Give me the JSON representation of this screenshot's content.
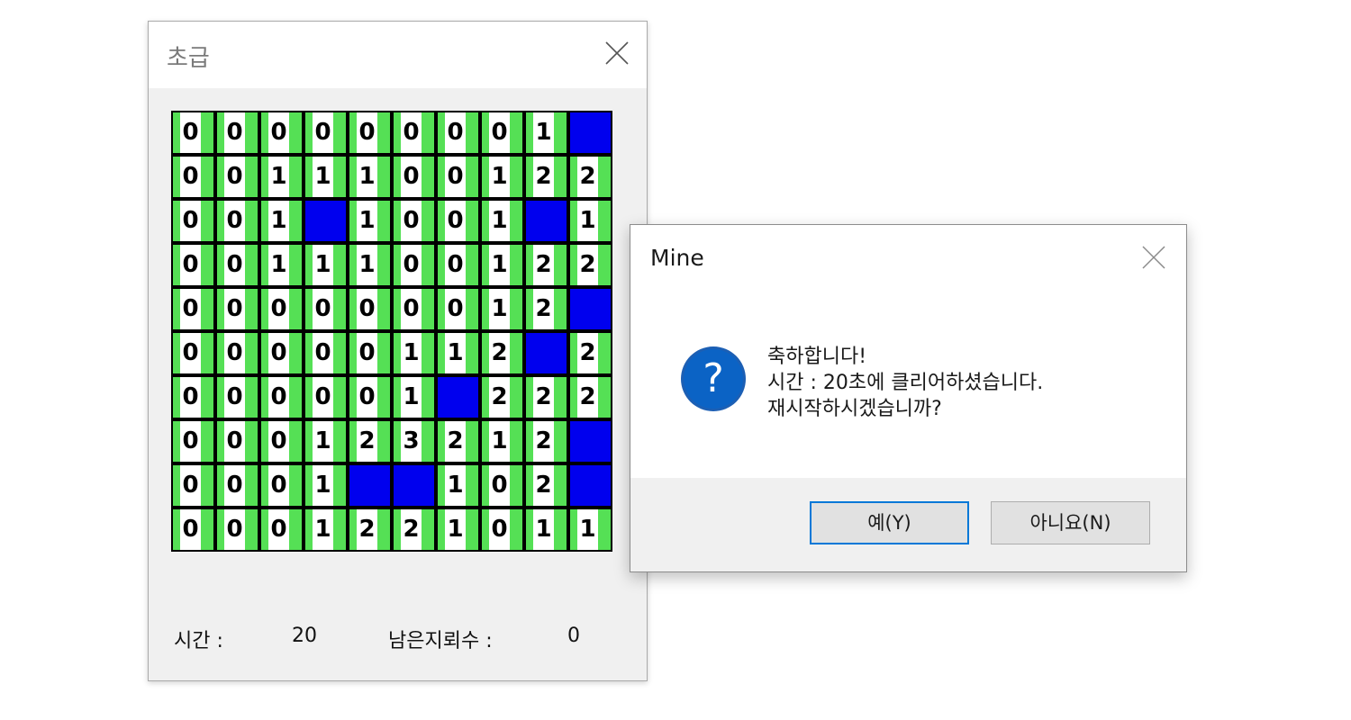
{
  "game_window": {
    "title": "초급",
    "status": {
      "time_label": "시간 :",
      "time_value": "20",
      "remaining_label": "남은지뢰수 :",
      "remaining_value": "0"
    },
    "board": [
      [
        "0",
        "0",
        "0",
        "0",
        "0",
        "0",
        "0",
        "0",
        "1",
        "M"
      ],
      [
        "0",
        "0",
        "1",
        "1",
        "1",
        "0",
        "0",
        "1",
        "2",
        "2"
      ],
      [
        "0",
        "0",
        "1",
        "M",
        "1",
        "0",
        "0",
        "1",
        "M",
        "1"
      ],
      [
        "0",
        "0",
        "1",
        "1",
        "1",
        "0",
        "0",
        "1",
        "2",
        "2"
      ],
      [
        "0",
        "0",
        "0",
        "0",
        "0",
        "0",
        "0",
        "1",
        "2",
        "M"
      ],
      [
        "0",
        "0",
        "0",
        "0",
        "0",
        "1",
        "1",
        "2",
        "M",
        "2"
      ],
      [
        "0",
        "0",
        "0",
        "0",
        "0",
        "1",
        "M",
        "2",
        "2",
        "2"
      ],
      [
        "0",
        "0",
        "0",
        "1",
        "2",
        "3",
        "2",
        "1",
        "2",
        "M"
      ],
      [
        "0",
        "0",
        "0",
        "1",
        "M",
        "M",
        "1",
        "0",
        "2",
        "M"
      ],
      [
        "0",
        "0",
        "0",
        "1",
        "2",
        "2",
        "1",
        "0",
        "1",
        "1"
      ]
    ],
    "colors": {
      "cell_green": "#3fd93f",
      "mine_blue": "#0000ee",
      "grid_black": "#000000"
    }
  },
  "dialog": {
    "title": "Mine",
    "icon": "question-icon",
    "message_lines": [
      "축하합니다!",
      "시간 : 20초에 클리어하셨습니다.",
      "재시작하시겠습니까?"
    ],
    "yes_label": "예(Y)",
    "no_label": "아니요(N)",
    "accent": "#0078d7"
  }
}
